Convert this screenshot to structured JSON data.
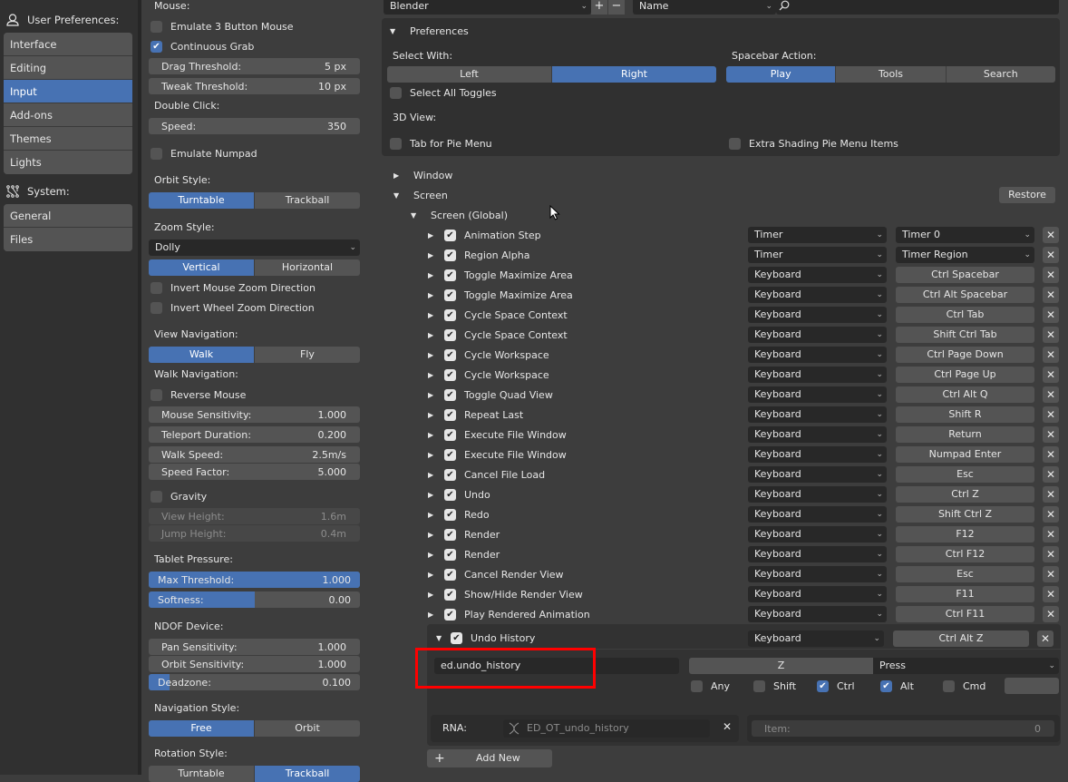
{
  "nav": {
    "user_prefs_header": "User Preferences:",
    "user_items": [
      {
        "label": "Interface",
        "active": false
      },
      {
        "label": "Editing",
        "active": false
      },
      {
        "label": "Input",
        "active": true
      },
      {
        "label": "Add-ons",
        "active": false
      },
      {
        "label": "Themes",
        "active": false
      },
      {
        "label": "Lights",
        "active": false
      }
    ],
    "system_header": "System:",
    "system_items": [
      {
        "label": "General",
        "active": false
      },
      {
        "label": "Files",
        "active": false
      }
    ]
  },
  "input": {
    "mouse_label": "Mouse:",
    "emulate_3_button": {
      "label": "Emulate 3 Button Mouse",
      "checked": false
    },
    "continuous_grab": {
      "label": "Continuous Grab",
      "checked": true
    },
    "drag_threshold": {
      "label": "Drag Threshold:",
      "value": "5 px"
    },
    "tweak_threshold": {
      "label": "Tweak Threshold:",
      "value": "10 px"
    },
    "double_click_label": "Double Click:",
    "speed": {
      "label": "Speed:",
      "value": "350"
    },
    "emulate_numpad": {
      "label": "Emulate Numpad",
      "checked": false
    },
    "orbit_style_label": "Orbit Style:",
    "orbit_style": {
      "options": [
        "Turntable",
        "Trackball"
      ],
      "selected": "Turntable"
    },
    "zoom_style_label": "Zoom Style:",
    "zoom_style_value": "Dolly",
    "zoom_axis": {
      "options": [
        "Vertical",
        "Horizontal"
      ],
      "selected": "Vertical"
    },
    "invert_mouse_zoom": {
      "label": "Invert Mouse Zoom Direction",
      "checked": false
    },
    "invert_wheel_zoom": {
      "label": "Invert Wheel Zoom Direction",
      "checked": false
    },
    "view_navigation_label": "View Navigation:",
    "view_navigation": {
      "options": [
        "Walk",
        "Fly"
      ],
      "selected": "Walk"
    },
    "walk_navigation_label": "Walk Navigation:",
    "reverse_mouse": {
      "label": "Reverse Mouse",
      "checked": false
    },
    "mouse_sensitivity": {
      "label": "Mouse Sensitivity:",
      "value": "1.000"
    },
    "teleport_duration": {
      "label": "Teleport Duration:",
      "value": "0.200"
    },
    "walk_speed": {
      "label": "Walk Speed:",
      "value": "2.5m/s"
    },
    "speed_factor": {
      "label": "Speed Factor:",
      "value": "5.000"
    },
    "gravity": {
      "label": "Gravity",
      "checked": false
    },
    "view_height": {
      "label": "View Height:",
      "value": "1.6m"
    },
    "jump_height": {
      "label": "Jump Height:",
      "value": "0.4m"
    },
    "tablet_pressure_label": "Tablet Pressure:",
    "max_threshold": {
      "label": "Max Threshold:",
      "value": "1.000",
      "fill_fraction": 1.0
    },
    "softness": {
      "label": "Softness:",
      "value": "0.00",
      "fill_fraction": 0.5
    },
    "ndof_label": "NDOF Device:",
    "pan_sensitivity": {
      "label": "Pan Sensitivity:",
      "value": "1.000"
    },
    "orbit_sensitivity": {
      "label": "Orbit Sensitivity:",
      "value": "1.000"
    },
    "deadzone": {
      "label": "Deadzone:",
      "value": "0.100",
      "fill_fraction": 0.1
    },
    "navigation_style_label": "Navigation Style:",
    "navigation_style": {
      "options": [
        "Free",
        "Orbit"
      ],
      "selected": "Free"
    },
    "rotation_style_label": "Rotation Style:",
    "rotation_style": {
      "options": [
        "Turntable",
        "Trackball"
      ],
      "selected": "Trackball"
    }
  },
  "keymap": {
    "preset_value": "Blender",
    "add_label": "+",
    "remove_label": "−",
    "search_mode_value": "Name",
    "search_value": "",
    "preferences_header": "Preferences",
    "select_with_label": "Select With:",
    "select_with": {
      "options": [
        "Left",
        "Right"
      ],
      "selected": "Right"
    },
    "spacebar_action_label": "Spacebar Action:",
    "spacebar_action": {
      "options": [
        "Play",
        "Tools",
        "Search"
      ],
      "selected": "Play"
    },
    "select_all_toggles": {
      "label": "Select All Toggles",
      "checked": false
    },
    "view3d_label": "3D View:",
    "tab_pie_menu": {
      "label": "Tab for Pie Menu",
      "checked": false
    },
    "extra_shading_pie": {
      "label": "Extra Shading Pie Menu Items",
      "checked": false
    },
    "window_section": "Window",
    "screen_section": "Screen",
    "restore_label": "Restore",
    "screen_global": "Screen (Global)",
    "items": [
      {
        "name": "Animation Step",
        "type": "Timer",
        "event": "Timer 0",
        "event_is_dropdown": true
      },
      {
        "name": "Region Alpha",
        "type": "Timer",
        "event": "Timer Region",
        "event_is_dropdown": true
      },
      {
        "name": "Toggle Maximize Area",
        "type": "Keyboard",
        "event": "Ctrl Spacebar"
      },
      {
        "name": "Toggle Maximize Area",
        "type": "Keyboard",
        "event": "Ctrl Alt Spacebar"
      },
      {
        "name": "Cycle Space Context",
        "type": "Keyboard",
        "event": "Ctrl Tab"
      },
      {
        "name": "Cycle Space Context",
        "type": "Keyboard",
        "event": "Shift Ctrl Tab"
      },
      {
        "name": "Cycle Workspace",
        "type": "Keyboard",
        "event": "Ctrl Page Down"
      },
      {
        "name": "Cycle Workspace",
        "type": "Keyboard",
        "event": "Ctrl Page Up"
      },
      {
        "name": "Toggle Quad View",
        "type": "Keyboard",
        "event": "Ctrl Alt Q"
      },
      {
        "name": "Repeat Last",
        "type": "Keyboard",
        "event": "Shift R"
      },
      {
        "name": "Execute File Window",
        "type": "Keyboard",
        "event": "Return"
      },
      {
        "name": "Execute File Window",
        "type": "Keyboard",
        "event": "Numpad Enter"
      },
      {
        "name": "Cancel File Load",
        "type": "Keyboard",
        "event": "Esc"
      },
      {
        "name": "Undo",
        "type": "Keyboard",
        "event": "Ctrl Z"
      },
      {
        "name": "Redo",
        "type": "Keyboard",
        "event": "Shift Ctrl Z"
      },
      {
        "name": "Render",
        "type": "Keyboard",
        "event": "F12"
      },
      {
        "name": "Render",
        "type": "Keyboard",
        "event": "Ctrl F12"
      },
      {
        "name": "Cancel Render View",
        "type": "Keyboard",
        "event": "Esc"
      },
      {
        "name": "Show/Hide Render View",
        "type": "Keyboard",
        "event": "F11"
      },
      {
        "name": "Play Rendered Animation",
        "type": "Keyboard",
        "event": "Ctrl F11"
      }
    ],
    "expanded": {
      "name": "Undo History",
      "type": "Keyboard",
      "event": "Ctrl Alt Z",
      "idname": "ed.undo_history",
      "key": "Z",
      "value": "Press",
      "modifiers": [
        {
          "label": "Any",
          "checked": false
        },
        {
          "label": "Shift",
          "checked": false
        },
        {
          "label": "Ctrl",
          "checked": true
        },
        {
          "label": "Alt",
          "checked": true
        },
        {
          "label": "Cmd",
          "checked": false
        }
      ],
      "rna_label": "RNA:",
      "rna_value": "ED_OT_undo_history",
      "item_label": "Item:",
      "item_value": "0"
    },
    "add_new_label": "Add New"
  },
  "colors": {
    "accent": "#4772b3",
    "highlight_box": "#ff0000"
  }
}
